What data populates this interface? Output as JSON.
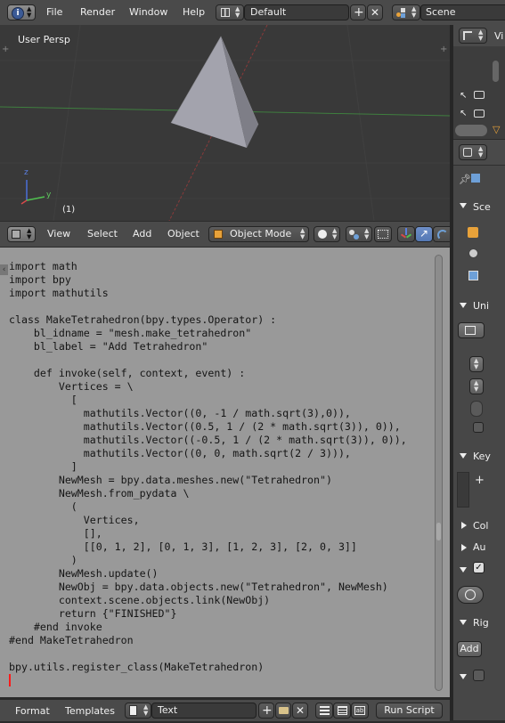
{
  "info_header": {
    "menus": [
      "File",
      "Render",
      "Window",
      "Help"
    ],
    "screen_layout": "Default",
    "scene": "Scene"
  },
  "viewport": {
    "label": "User Persp",
    "object_count": "(1)",
    "axis_labels": {
      "z": "z",
      "y": "y"
    }
  },
  "view3d_header": {
    "menus": [
      "View",
      "Select",
      "Add",
      "Object"
    ],
    "mode": "Object Mode"
  },
  "text_editor": {
    "lines": [
      "import math",
      "import bpy",
      "import mathutils",
      "",
      "class MakeTetrahedron(bpy.types.Operator) :",
      "    bl_idname = \"mesh.make_tetrahedron\"",
      "    bl_label = \"Add Tetrahedron\"",
      "",
      "    def invoke(self, context, event) :",
      "        Vertices = \\",
      "          [",
      "            mathutils.Vector((0, -1 / math.sqrt(3),0)),",
      "            mathutils.Vector((0.5, 1 / (2 * math.sqrt(3)), 0)),",
      "            mathutils.Vector((-0.5, 1 / (2 * math.sqrt(3)), 0)),",
      "            mathutils.Vector((0, 0, math.sqrt(2 / 3))),",
      "          ]",
      "        NewMesh = bpy.data.meshes.new(\"Tetrahedron\")",
      "        NewMesh.from_pydata \\",
      "          (",
      "            Vertices,",
      "            [],",
      "            [[0, 1, 2], [0, 1, 3], [1, 2, 3], [2, 0, 3]]",
      "          )",
      "        NewMesh.update()",
      "        NewObj = bpy.data.objects.new(\"Tetrahedron\", NewMesh)",
      "        context.scene.objects.link(NewObj)",
      "        return {\"FINISHED\"}",
      "    #end invoke",
      "#end MakeTetrahedron",
      "",
      "bpy.utils.register_class(MakeTetrahedron)"
    ]
  },
  "text_footer": {
    "menus": [
      "Format",
      "Templates"
    ],
    "datablock_name": "Text",
    "run_button": "Run Script"
  },
  "right_panel": {
    "outliner_label": "Vi",
    "sections": [
      "Sce",
      "Uni",
      "Key",
      "Col",
      "Au",
      "Rig"
    ],
    "add_button": "Add"
  }
}
